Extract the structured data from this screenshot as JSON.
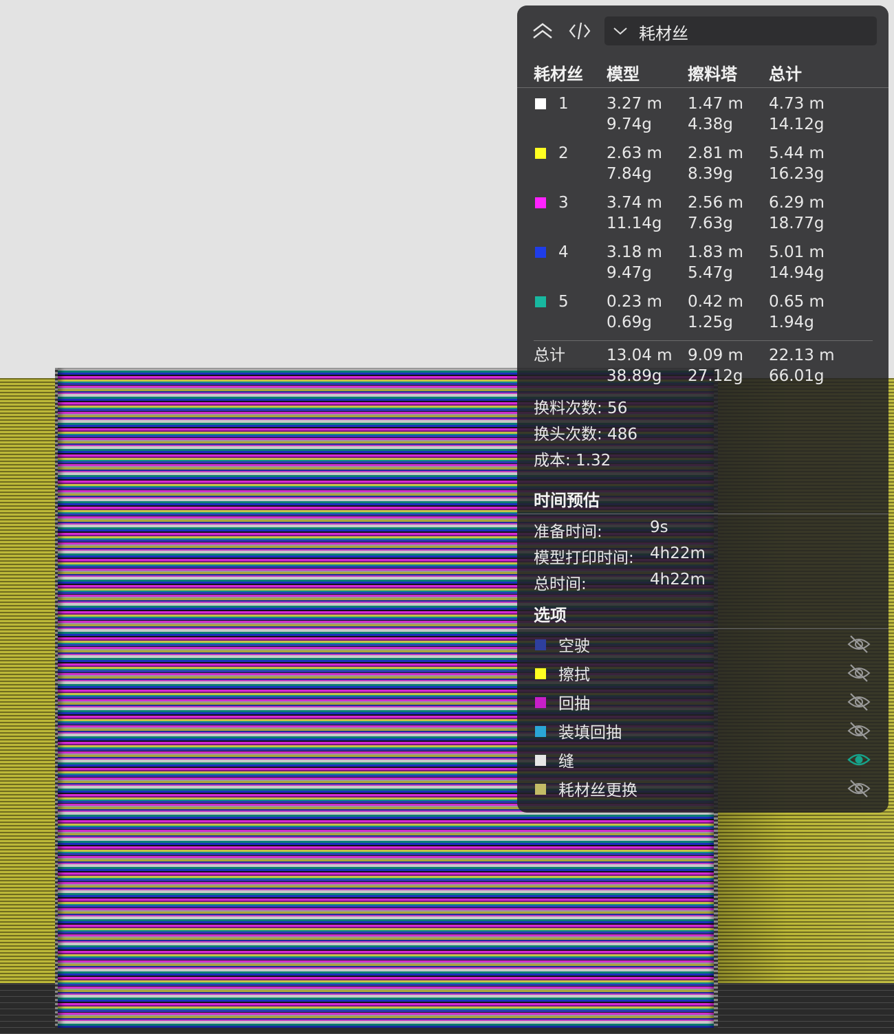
{
  "viewport": {
    "colors": {
      "sky": "#e3e3e3",
      "wall": "#a8a332",
      "plate": "#2a2a2a"
    }
  },
  "panel": {
    "toolbar": {
      "collapse_icon": "collapse-chevrons-icon",
      "code_icon": "code-brackets-icon",
      "view_select": {
        "value": "耗材丝",
        "icon": "chevron-down-icon"
      }
    },
    "table": {
      "headers": {
        "filament": "耗材丝",
        "model": "模型",
        "tower": "擦料塔",
        "total": "总计"
      },
      "rows": [
        {
          "id": "1",
          "color": "#ffffff",
          "model_len": "3.27 m",
          "model_wt": "9.74g",
          "tower_len": "1.47 m",
          "tower_wt": "4.38g",
          "total_len": "4.73 m",
          "total_wt": "14.12g"
        },
        {
          "id": "2",
          "color": "#ffff22",
          "model_len": "2.63 m",
          "model_wt": "7.84g",
          "tower_len": "2.81 m",
          "tower_wt": "8.39g",
          "total_len": "5.44 m",
          "total_wt": "16.23g"
        },
        {
          "id": "3",
          "color": "#ff22ff",
          "model_len": "3.74 m",
          "model_wt": "11.14g",
          "tower_len": "2.56 m",
          "tower_wt": "7.63g",
          "total_len": "6.29 m",
          "total_wt": "18.77g"
        },
        {
          "id": "4",
          "color": "#1f3de8",
          "model_len": "3.18 m",
          "model_wt": "9.47g",
          "tower_len": "1.83 m",
          "tower_wt": "5.47g",
          "total_len": "5.01 m",
          "total_wt": "14.94g"
        },
        {
          "id": "5",
          "color": "#18b8a0",
          "model_len": "0.23 m",
          "model_wt": "0.69g",
          "tower_len": "0.42 m",
          "tower_wt": "1.25g",
          "total_len": "0.65 m",
          "total_wt": "1.94g"
        }
      ],
      "total": {
        "label": "总计",
        "model_len": "13.04 m",
        "model_wt": "38.89g",
        "tower_len": "9.09 m",
        "tower_wt": "27.12g",
        "total_len": "22.13 m",
        "total_wt": "66.01g"
      }
    },
    "stats": {
      "filament_changes": "换料次数:  56",
      "head_changes": "换头次数:  486",
      "cost": "成本:  1.32"
    },
    "time": {
      "title": "时间预估",
      "prep_label": "准备时间:",
      "prep_value": "9s",
      "model_label": "模型打印时间:",
      "model_value": "4h22m",
      "total_label": "总时间:",
      "total_value": "4h22m"
    },
    "options": {
      "title": "选项",
      "items": [
        {
          "label": "空驶",
          "color": "#2e3f9e",
          "visible": false
        },
        {
          "label": "擦拭",
          "color": "#ffff22",
          "visible": false
        },
        {
          "label": "回抽",
          "color": "#c81fc8",
          "visible": false
        },
        {
          "label": "装填回抽",
          "color": "#2aa6d6",
          "visible": false
        },
        {
          "label": "缝",
          "color": "#e6e6e6",
          "visible": true
        },
        {
          "label": "耗材丝更换",
          "color": "#c3bc66",
          "visible": false
        }
      ],
      "eye_icon": "eye-icon",
      "eye_hidden_icon": "eye-off-icon",
      "eye_active_color": "#16a38a"
    }
  }
}
